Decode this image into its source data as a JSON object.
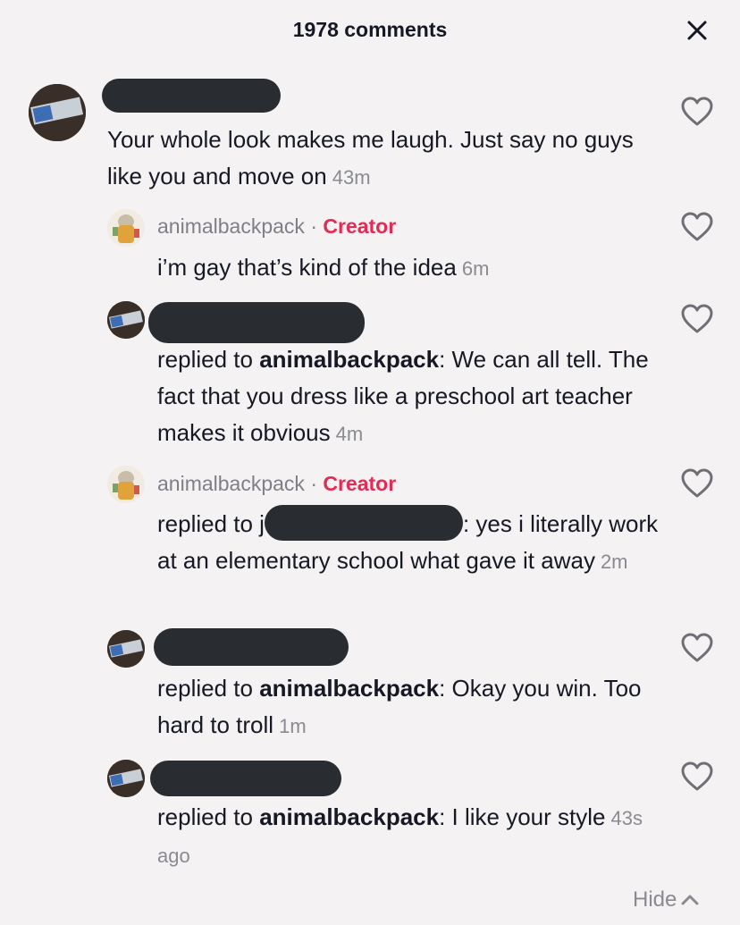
{
  "header": {
    "title": "1978 comments",
    "close_icon": "close-icon"
  },
  "comments": [
    {
      "text": "Your whole look makes me laugh. Just say no guys like you and move on",
      "time": "43m"
    },
    {
      "username": "animalbackpack",
      "separator": "·",
      "badge": "Creator",
      "text": "i’m gay that’s kind of the idea",
      "time": "6m"
    },
    {
      "prefix": "replied to ",
      "mention": "animalbackpack",
      "text": ": We can all tell. The fact that you dress like a preschool art teacher makes it obvious",
      "time": "4m"
    },
    {
      "username": "animalbackpack",
      "separator": "·",
      "badge": "Creator",
      "prefix": "replied to j",
      "text": ": yes i literally work at an elementary school what gave it away",
      "time": "2m"
    },
    {
      "prefix": "replied to ",
      "mention": "animalbackpack",
      "text": ": Okay you win. Too hard to troll",
      "time": "1m"
    },
    {
      "prefix": "replied to ",
      "mention": "animalbackpack",
      "text": ": I like your style",
      "time": "43s ago"
    }
  ],
  "footer": {
    "hide_label": "Hide",
    "hide_icon": "chevron-up-icon"
  },
  "colors": {
    "background": "#f4f2f3",
    "creator": "#e62a54",
    "muted": "#8a8a91",
    "redaction": "#292d31"
  }
}
